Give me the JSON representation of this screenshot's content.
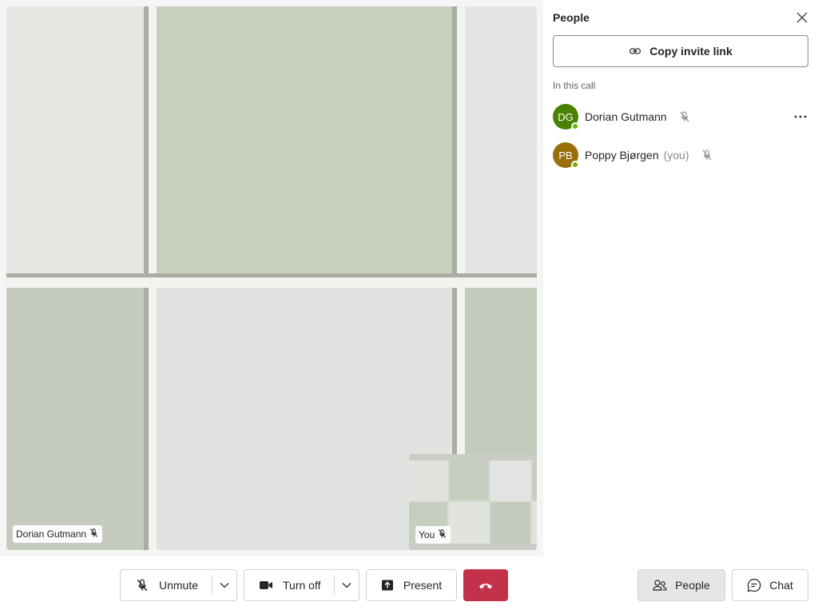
{
  "stage": {
    "main_participant_name": "Dorian Gutmann",
    "self_label": "You"
  },
  "panel": {
    "title": "People",
    "copy_invite_label": "Copy invite link",
    "section_label": "In this call",
    "people": [
      {
        "initials": "DG",
        "name": "Dorian Gutmann",
        "suffix": "",
        "avatar_color": "#498205",
        "muted": true
      },
      {
        "initials": "PB",
        "name": "Poppy Bjørgen",
        "suffix": "(you)",
        "avatar_color": "#986f0b",
        "muted": true
      }
    ]
  },
  "toolbar": {
    "unmute_label": "Unmute",
    "camera_label": "Turn off",
    "present_label": "Present",
    "people_label": "People",
    "chat_label": "Chat"
  },
  "colors": {
    "hangup": "#c4314b",
    "presence_available": "#6bb700",
    "active_toggle_bg": "#e6e6e6"
  }
}
